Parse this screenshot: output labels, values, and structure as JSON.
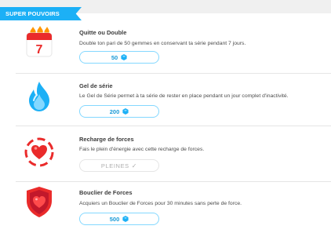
{
  "section": {
    "title": "SUPER POUVOIRS"
  },
  "items": [
    {
      "title": "Quitte ou Double",
      "description": "Double ton pari de 50 gemmes en conservant ta série pendant 7 jours.",
      "icon": "calendar-icon",
      "calendar_day": "7",
      "button_label": "50"
    },
    {
      "title": "Gel de série",
      "description": "Le Gel de Série permet à ta série de rester en place pendant un jour complet d'inactivité.",
      "icon": "ice-flame-icon",
      "button_label": "200"
    },
    {
      "title": "Recharge de forces",
      "description": "Fais le plein d'énergie avec cette recharge de forces.",
      "icon": "heart-refill-icon",
      "button_label": "PLEINES"
    },
    {
      "title": "Bouclier de Forces",
      "description": "Acquiers un Bouclier de Forces pour 30 minutes sans perte de force.",
      "icon": "heart-shield-icon",
      "button_label": "500"
    }
  ],
  "colors": {
    "accent": "#1cb0f6",
    "gem": "#1cb0f6",
    "heart": "#ea2b2b",
    "ice": "#1cb0f6"
  }
}
